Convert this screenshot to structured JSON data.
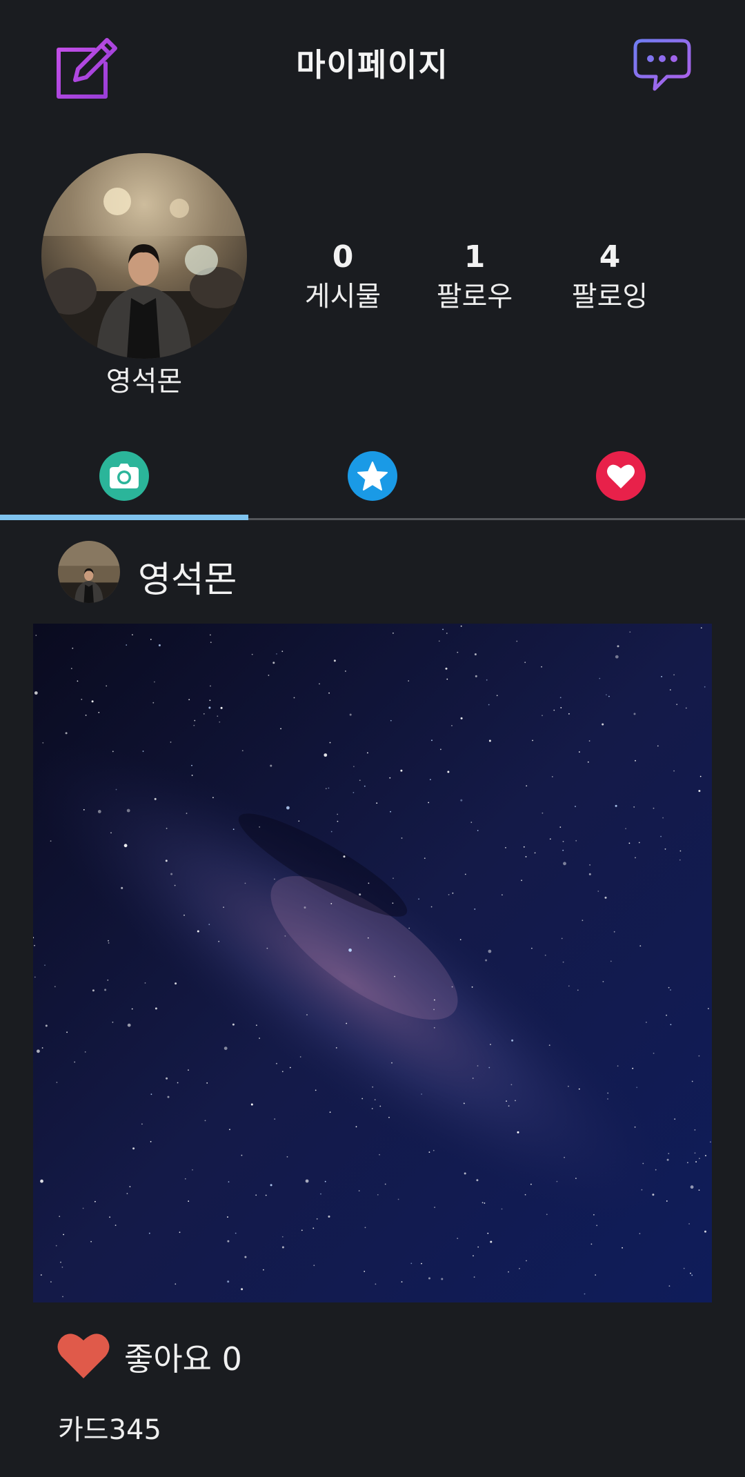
{
  "header": {
    "title": "마이페이지",
    "edit_icon": "edit-icon",
    "chat_icon": "chat-bubble-icon"
  },
  "profile": {
    "name": "영석몬",
    "stats": [
      {
        "count": "0",
        "label": "게시물"
      },
      {
        "count": "1",
        "label": "팔로우"
      },
      {
        "count": "4",
        "label": "팔로잉"
      }
    ]
  },
  "tabs": [
    {
      "icon": "camera-icon",
      "color": "#2bb59a",
      "active": true
    },
    {
      "icon": "star-icon",
      "color": "#1a9ae6",
      "active": false
    },
    {
      "icon": "heart-icon",
      "color": "#e8214a",
      "active": false
    }
  ],
  "post": {
    "author": "영석몬",
    "likes_text": "좋아요 0",
    "caption": "카드345"
  },
  "colors": {
    "background": "#1a1c20",
    "tab_indicator": "#7fc3ee",
    "like_heart": "#e05a4a",
    "edit_icon": "#b044e0",
    "chat_icon": "#8a6ff0"
  }
}
